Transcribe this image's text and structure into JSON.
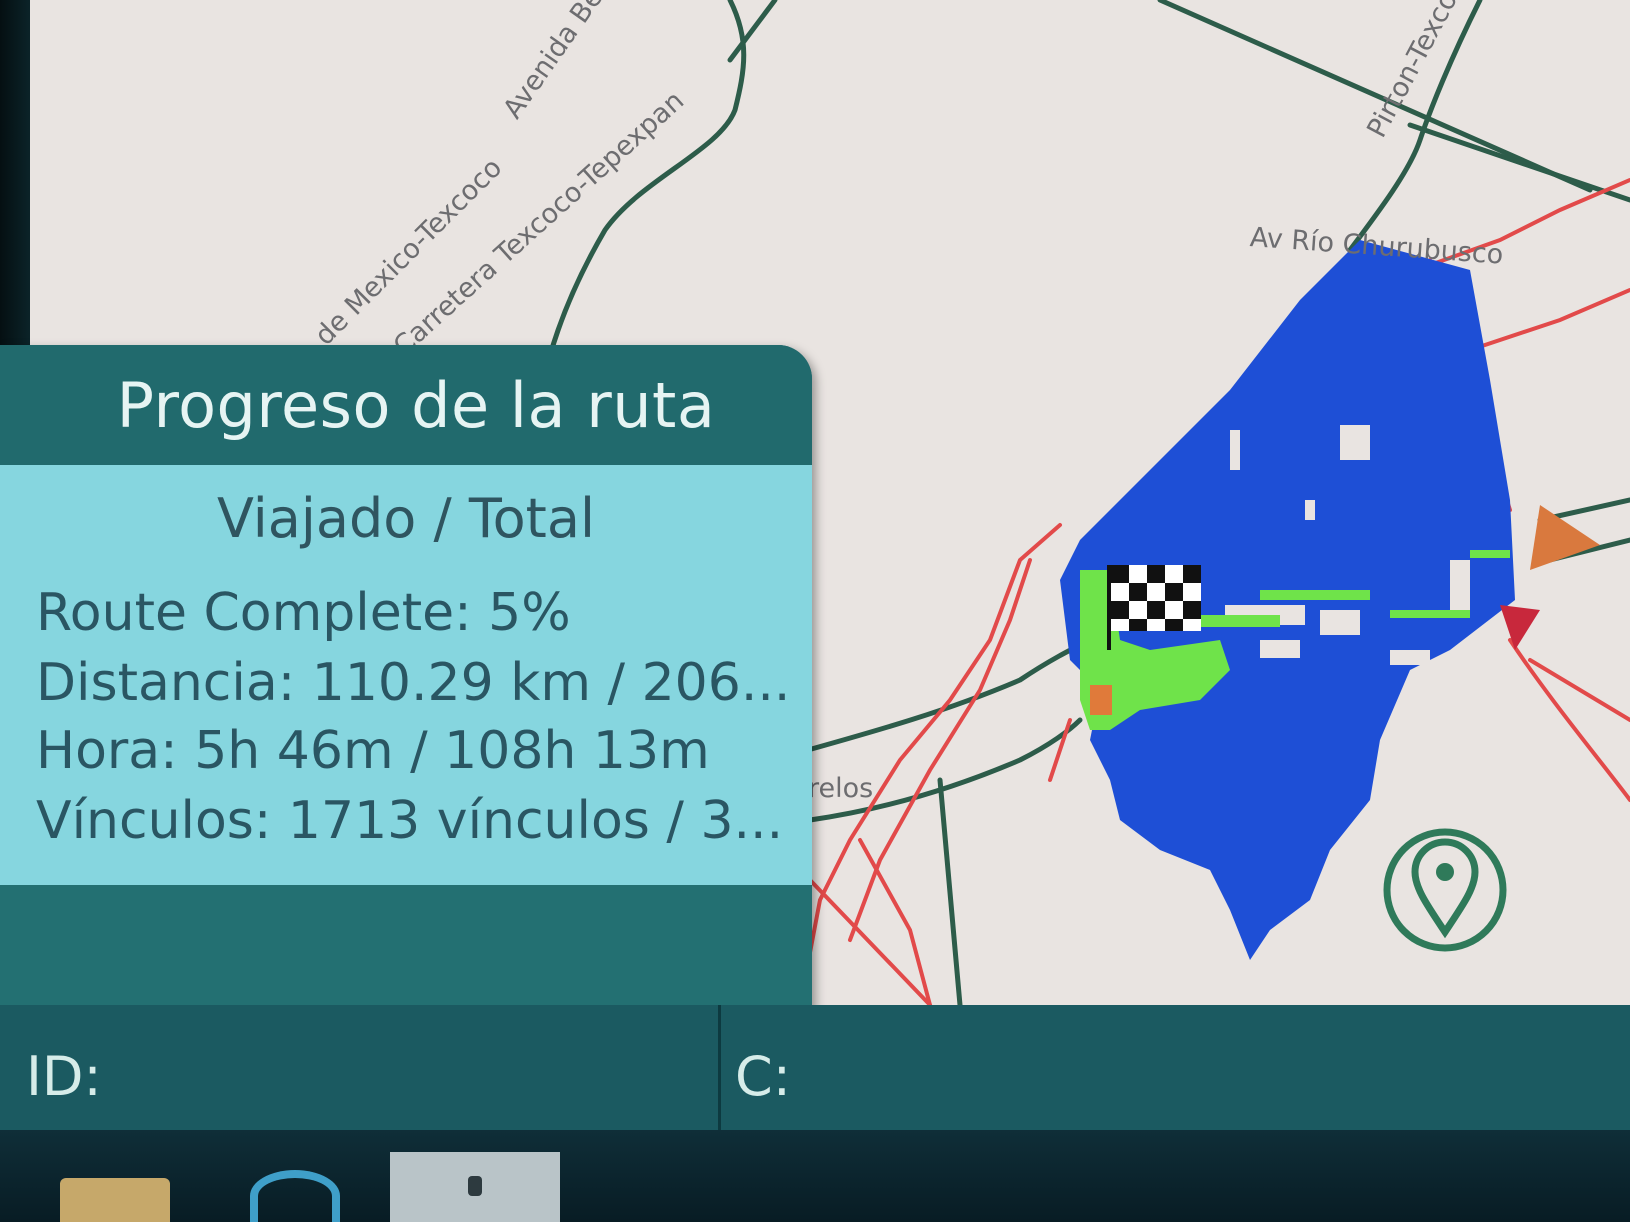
{
  "map": {
    "roads": {
      "label_1": "Avenida Be",
      "label_2": "de Mexico-Texcoco",
      "label_3": "Carretera Texcoco-Tepexpan",
      "label_4": "Pirton-Texco",
      "label_5": "Av Río Churubusco",
      "label_6": "relos"
    },
    "colors": {
      "background": "#e9e4e1",
      "covered_area": "#1e4fd6",
      "traveled": "#6fe34a",
      "routes_red": "#e24a4a",
      "roads_green": "#2d5c4a"
    }
  },
  "progress_panel": {
    "title": "Progreso de la ruta",
    "subtitle": "Viajado / Total",
    "route_complete": "Route Complete: 5%",
    "distance": "Distancia: 110.29 km / 206...",
    "time": "Hora: 5h 46m / 108h 13m",
    "links": "Vínculos: 1713 vínculos / 3..."
  },
  "status_bar": {
    "id_label": "ID:",
    "c_label": "C:"
  },
  "icons": {
    "finish_flag": "checkered-flag-icon",
    "location": "location-pin-icon"
  }
}
